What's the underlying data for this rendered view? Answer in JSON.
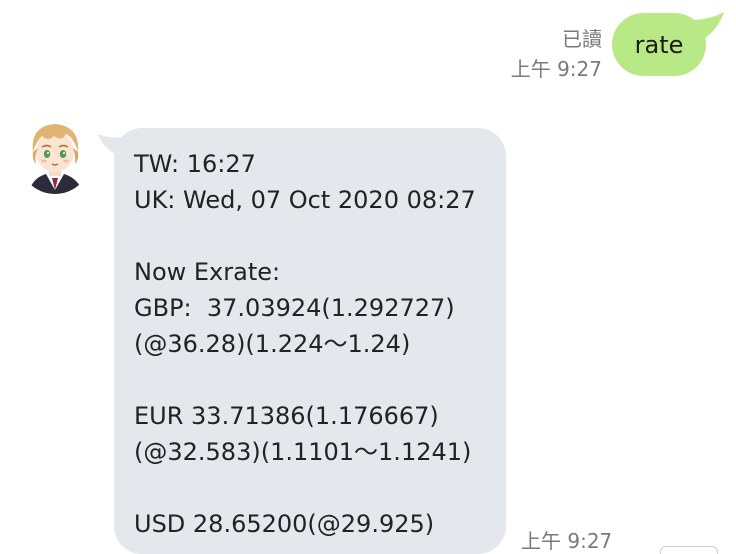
{
  "outgoing": {
    "text": "rate",
    "read_label": "已讀",
    "time": "上午 9:27",
    "bubble_color": "#b8e986"
  },
  "incoming": {
    "avatar_icon": "anime-boy-avatar",
    "lines": [
      "TW: 16:27",
      "UK: Wed, 07 Oct 2020 08:27",
      "",
      "Now Exrate:",
      "GBP:  37.03924(1.292727)",
      "(@36.28)(1.224～1.24)",
      "",
      "EUR 33.71386(1.176667)",
      "(@32.583)(1.1101～1.1241)",
      "",
      "USD 28.65200(@29.925)"
    ],
    "time": "上午 9:27",
    "bubble_color": "#e4e7ec"
  }
}
